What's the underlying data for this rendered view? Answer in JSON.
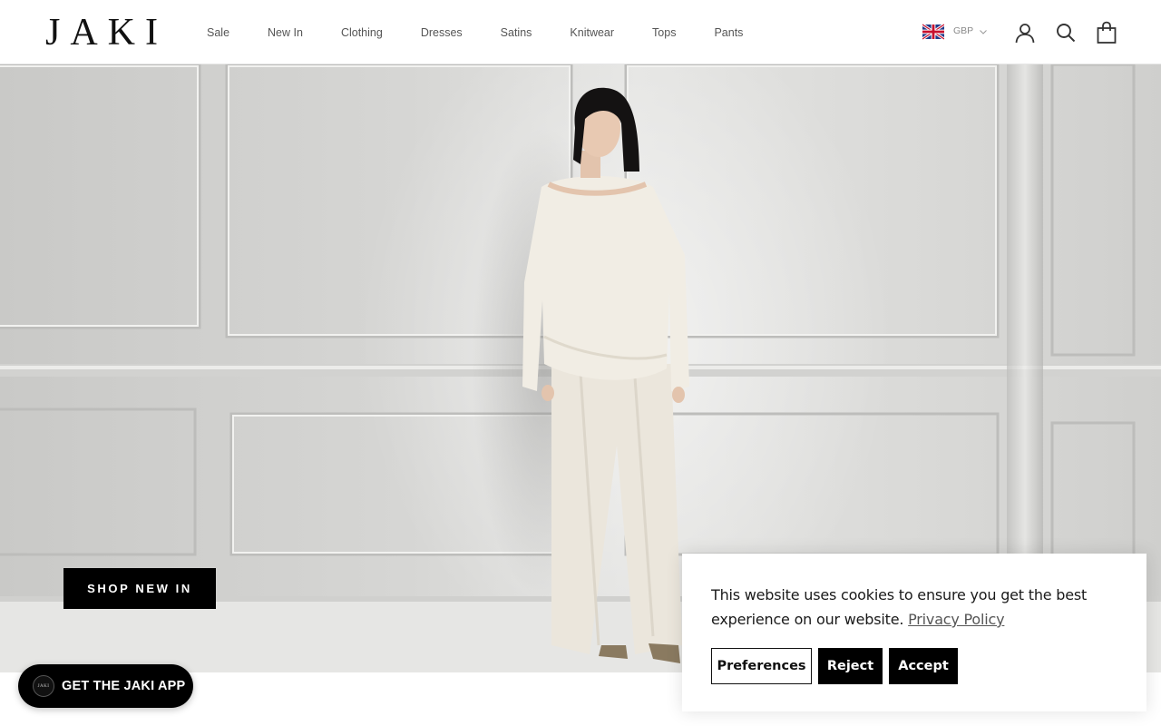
{
  "brand": {
    "logo_text": "JAKI"
  },
  "nav": {
    "items": [
      {
        "label": "Sale"
      },
      {
        "label": "New In"
      },
      {
        "label": "Clothing"
      },
      {
        "label": "Dresses"
      },
      {
        "label": "Satins"
      },
      {
        "label": "Knitwear"
      },
      {
        "label": "Tops"
      },
      {
        "label": "Pants"
      }
    ]
  },
  "header": {
    "currency": "GBP",
    "icons": {
      "flag": "uk-flag-icon",
      "account": "account-icon",
      "search": "search-icon",
      "cart": "cart-icon"
    }
  },
  "hero": {
    "cta_label": "SHOP NEW IN",
    "image_subject": "model-in-cream-knit-and-wide-leg-pants"
  },
  "app_promo": {
    "label": "GET THE JAKI APP",
    "logo_text": "JAKI"
  },
  "cookie_banner": {
    "message": "This website uses cookies to ensure you get the best experience on our website.",
    "link_label": "Privacy Policy",
    "buttons": {
      "preferences": "Preferences",
      "reject": "Reject",
      "accept": "Accept"
    }
  },
  "colors": {
    "accent": "#000000",
    "background": "#ffffff",
    "nav_text": "#555555"
  }
}
